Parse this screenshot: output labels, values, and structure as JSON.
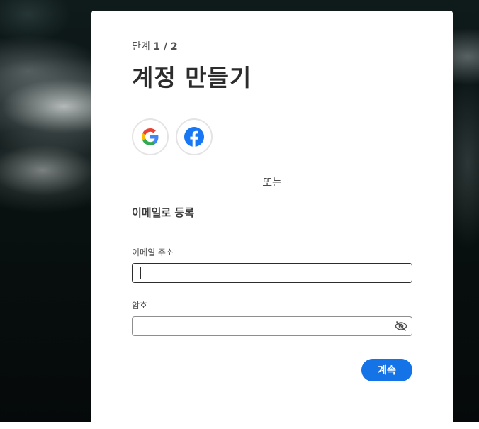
{
  "step": {
    "prefix": "단계",
    "value": "1 / 2"
  },
  "title": "계정 만들기",
  "social": [
    {
      "name": "google",
      "icon": "google-icon"
    },
    {
      "name": "facebook",
      "icon": "facebook-icon"
    }
  ],
  "divider_text": "또는",
  "email_section_title": "이메일로 등록",
  "email": {
    "label": "이메일 주소",
    "value": ""
  },
  "password": {
    "label": "암호",
    "value": "",
    "toggle_icon": "eye-slash-icon"
  },
  "continue_label": "계속",
  "colors": {
    "accent": "#1473e6",
    "text": "#2c2c2c",
    "card": "#ffffff"
  }
}
